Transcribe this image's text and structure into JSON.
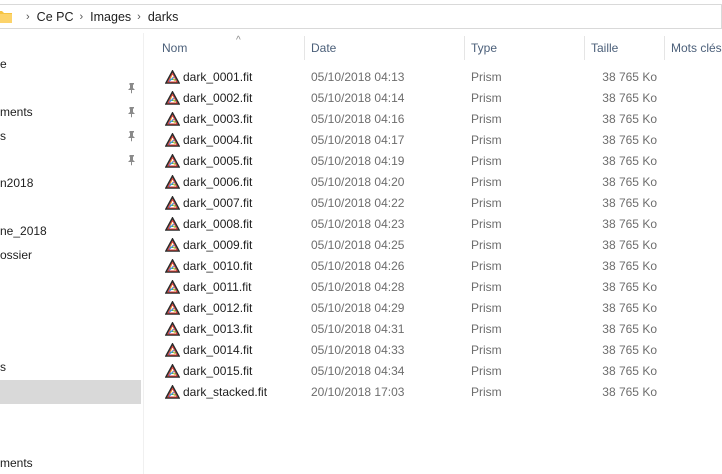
{
  "breadcrumb": [
    "Ce PC",
    "Images",
    "darks"
  ],
  "nav": {
    "items": [
      {
        "label": "e",
        "top": 0
      },
      {
        "label": "ments",
        "pinned": true
      },
      {
        "label": "s",
        "pinned": true
      },
      {
        "label": "",
        "pinned": true
      },
      {
        "label": "n2018"
      },
      {
        "label": "ne_2018"
      },
      {
        "label": "ossier"
      },
      {
        "label": "s"
      },
      {
        "label": ""
      },
      {
        "label": "ments"
      }
    ]
  },
  "columns": {
    "name": "Nom",
    "date": "Date",
    "type": "Type",
    "size": "Taille",
    "tags": "Mots clés"
  },
  "files": [
    {
      "name": "dark_0001.fit",
      "date": "05/10/2018 04:13",
      "type": "Prism",
      "size": "38 765 Ko"
    },
    {
      "name": "dark_0002.fit",
      "date": "05/10/2018 04:14",
      "type": "Prism",
      "size": "38 765 Ko"
    },
    {
      "name": "dark_0003.fit",
      "date": "05/10/2018 04:16",
      "type": "Prism",
      "size": "38 765 Ko"
    },
    {
      "name": "dark_0004.fit",
      "date": "05/10/2018 04:17",
      "type": "Prism",
      "size": "38 765 Ko"
    },
    {
      "name": "dark_0005.fit",
      "date": "05/10/2018 04:19",
      "type": "Prism",
      "size": "38 765 Ko"
    },
    {
      "name": "dark_0006.fit",
      "date": "05/10/2018 04:20",
      "type": "Prism",
      "size": "38 765 Ko"
    },
    {
      "name": "dark_0007.fit",
      "date": "05/10/2018 04:22",
      "type": "Prism",
      "size": "38 765 Ko"
    },
    {
      "name": "dark_0008.fit",
      "date": "05/10/2018 04:23",
      "type": "Prism",
      "size": "38 765 Ko"
    },
    {
      "name": "dark_0009.fit",
      "date": "05/10/2018 04:25",
      "type": "Prism",
      "size": "38 765 Ko"
    },
    {
      "name": "dark_0010.fit",
      "date": "05/10/2018 04:26",
      "type": "Prism",
      "size": "38 765 Ko"
    },
    {
      "name": "dark_0011.fit",
      "date": "05/10/2018 04:28",
      "type": "Prism",
      "size": "38 765 Ko"
    },
    {
      "name": "dark_0012.fit",
      "date": "05/10/2018 04:29",
      "type": "Prism",
      "size": "38 765 Ko"
    },
    {
      "name": "dark_0013.fit",
      "date": "05/10/2018 04:31",
      "type": "Prism",
      "size": "38 765 Ko"
    },
    {
      "name": "dark_0014.fit",
      "date": "05/10/2018 04:33",
      "type": "Prism",
      "size": "38 765 Ko"
    },
    {
      "name": "dark_0015.fit",
      "date": "05/10/2018 04:34",
      "type": "Prism",
      "size": "38 765 Ko"
    },
    {
      "name": "dark_stacked.fit",
      "date": "20/10/2018 17:03",
      "type": "Prism",
      "size": "38 765 Ko"
    }
  ],
  "icons": {
    "folder": "folder-icon",
    "file": "prism-file-icon",
    "pin": "pin-icon",
    "separator": "chevron-right-icon"
  }
}
